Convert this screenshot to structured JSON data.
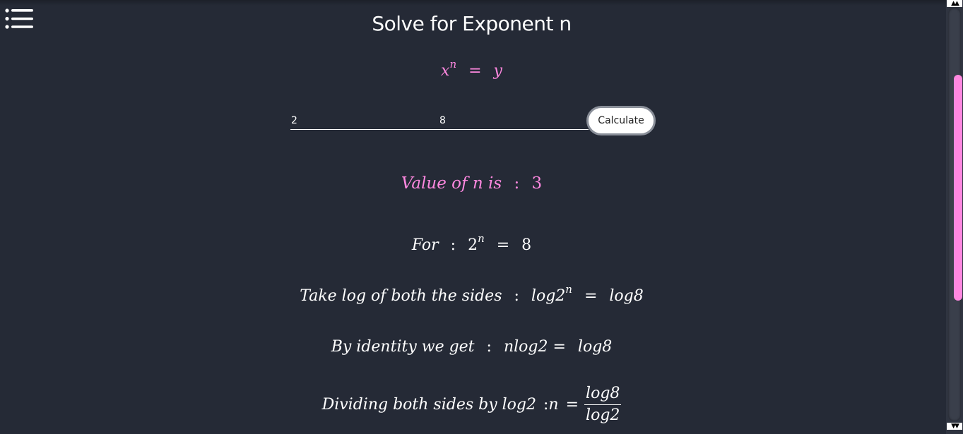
{
  "header": {
    "title": "Solve for Exponent n",
    "menu_icon": "list-icon"
  },
  "formula": {
    "base": "x",
    "exponent": "n",
    "equals": "=",
    "rhs": "y"
  },
  "inputs": {
    "x_value": "2",
    "y_value": "8",
    "calculate_label": "Calculate"
  },
  "result": {
    "label": "Value of n is",
    "separator": ":",
    "value": "3"
  },
  "steps": {
    "step1": {
      "label": "For",
      "sep": ":",
      "base": "2",
      "exp": "n",
      "eq": "=",
      "rhs": "8"
    },
    "step2": {
      "label": "Take log of both the sides",
      "sep": ":",
      "lhs": "log2",
      "exp": "n",
      "eq": "=",
      "rhs": "log8"
    },
    "step3": {
      "label": "By identity we get",
      "sep": ":",
      "lhs": "nlog2",
      "eq": "=",
      "rhs": "log8"
    },
    "step4": {
      "label": "Dividing both sides by log2",
      "sep": ":",
      "lhs": "n",
      "eq": "=",
      "numerator": "log8",
      "denominator": "log2"
    }
  },
  "colors": {
    "background": "#252a36",
    "accent": "#ff88e0",
    "text": "#ffffff"
  },
  "scrollbar": {
    "up_arrow": "▲▲",
    "down_arrow": "▼▼"
  }
}
